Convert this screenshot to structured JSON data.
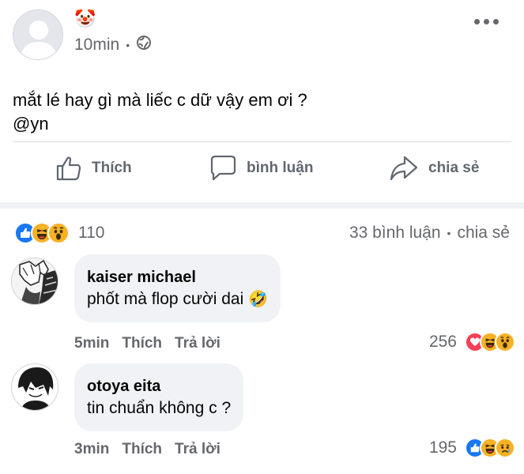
{
  "post": {
    "author_emoji": "🤡",
    "time": "10min",
    "separator": "•",
    "text_line1": "mắt lé hay gì mà liếc c dữ vậy em ơi ?",
    "text_line2": "@yn"
  },
  "actions": {
    "like": "Thích",
    "comment": "bình luận",
    "share": "chia sẻ"
  },
  "reactions": {
    "count": "110",
    "comments": "33  bình luận",
    "dot": "•",
    "shares": "chia sẻ",
    "types": [
      "like",
      "haha",
      "wow"
    ]
  },
  "comments": [
    {
      "name": "kaiser michael",
      "text": "phốt mà flop cười dai",
      "emoji": "🤣",
      "time": "5min",
      "like": "Thích",
      "reply": "Trả lời",
      "react_count": "256",
      "react_types": [
        "love",
        "haha",
        "wow"
      ]
    },
    {
      "name": "otoya eita",
      "text": "tin chuẩn không c ?",
      "time": "3min",
      "like": "Thích",
      "reply": "Trả lời",
      "react_count": "195",
      "react_types": [
        "like",
        "haha",
        "sad"
      ]
    }
  ],
  "colors": {
    "like_blue": "#1877f2",
    "love_red": "#f33e58",
    "emoji_yellow": "#f7b125",
    "muted_text": "#65676b"
  }
}
